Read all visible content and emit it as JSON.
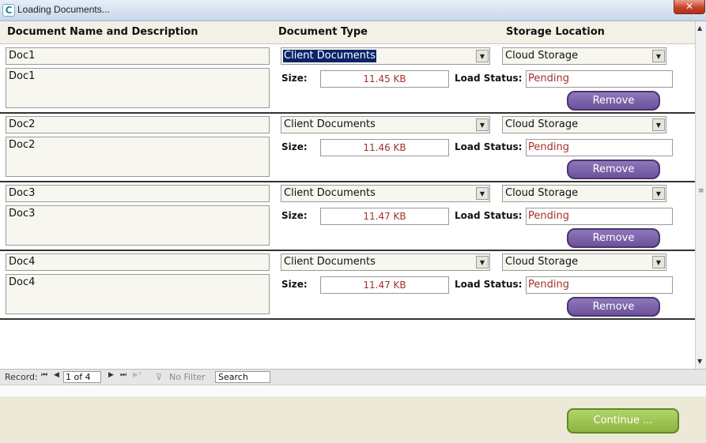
{
  "window": {
    "title": "Loading Documents...",
    "close_glyph": "✕",
    "icon_letter": "C"
  },
  "columns": {
    "name": "Document Name and Description",
    "type": "Document Type",
    "location": "Storage Location"
  },
  "labels": {
    "size": "Size:",
    "status": "Load Status:",
    "remove": "Remove"
  },
  "records": [
    {
      "name": "Doc1",
      "description": "Doc1",
      "type": "Client Documents",
      "location": "Cloud Storage",
      "size": "11.45 KB",
      "status": "Pending"
    },
    {
      "name": "Doc2",
      "description": "Doc2",
      "type": "Client Documents",
      "location": "Cloud Storage",
      "size": "11.46 KB",
      "status": "Pending"
    },
    {
      "name": "Doc3",
      "description": "Doc3",
      "type": "Client Documents",
      "location": "Cloud Storage",
      "size": "11.47 KB",
      "status": "Pending"
    },
    {
      "name": "Doc4",
      "description": "Doc4",
      "type": "Client Documents",
      "location": "Cloud Storage",
      "size": "11.47 KB",
      "status": "Pending"
    }
  ],
  "navigation": {
    "record_label": "Record:",
    "position": "1 of 4",
    "filter_label": "No Filter",
    "search_label": "Search",
    "icons": {
      "first": "⏮",
      "prev": "◀",
      "next": "▶",
      "last": "⏭",
      "new": "▶*"
    }
  },
  "footer": {
    "continue_label": "Continue ..."
  },
  "colors": {
    "remove_button": "#7a5fa8",
    "continue_button": "#9fc450",
    "value_text": "#a0322a",
    "selection": "#0a246a"
  }
}
